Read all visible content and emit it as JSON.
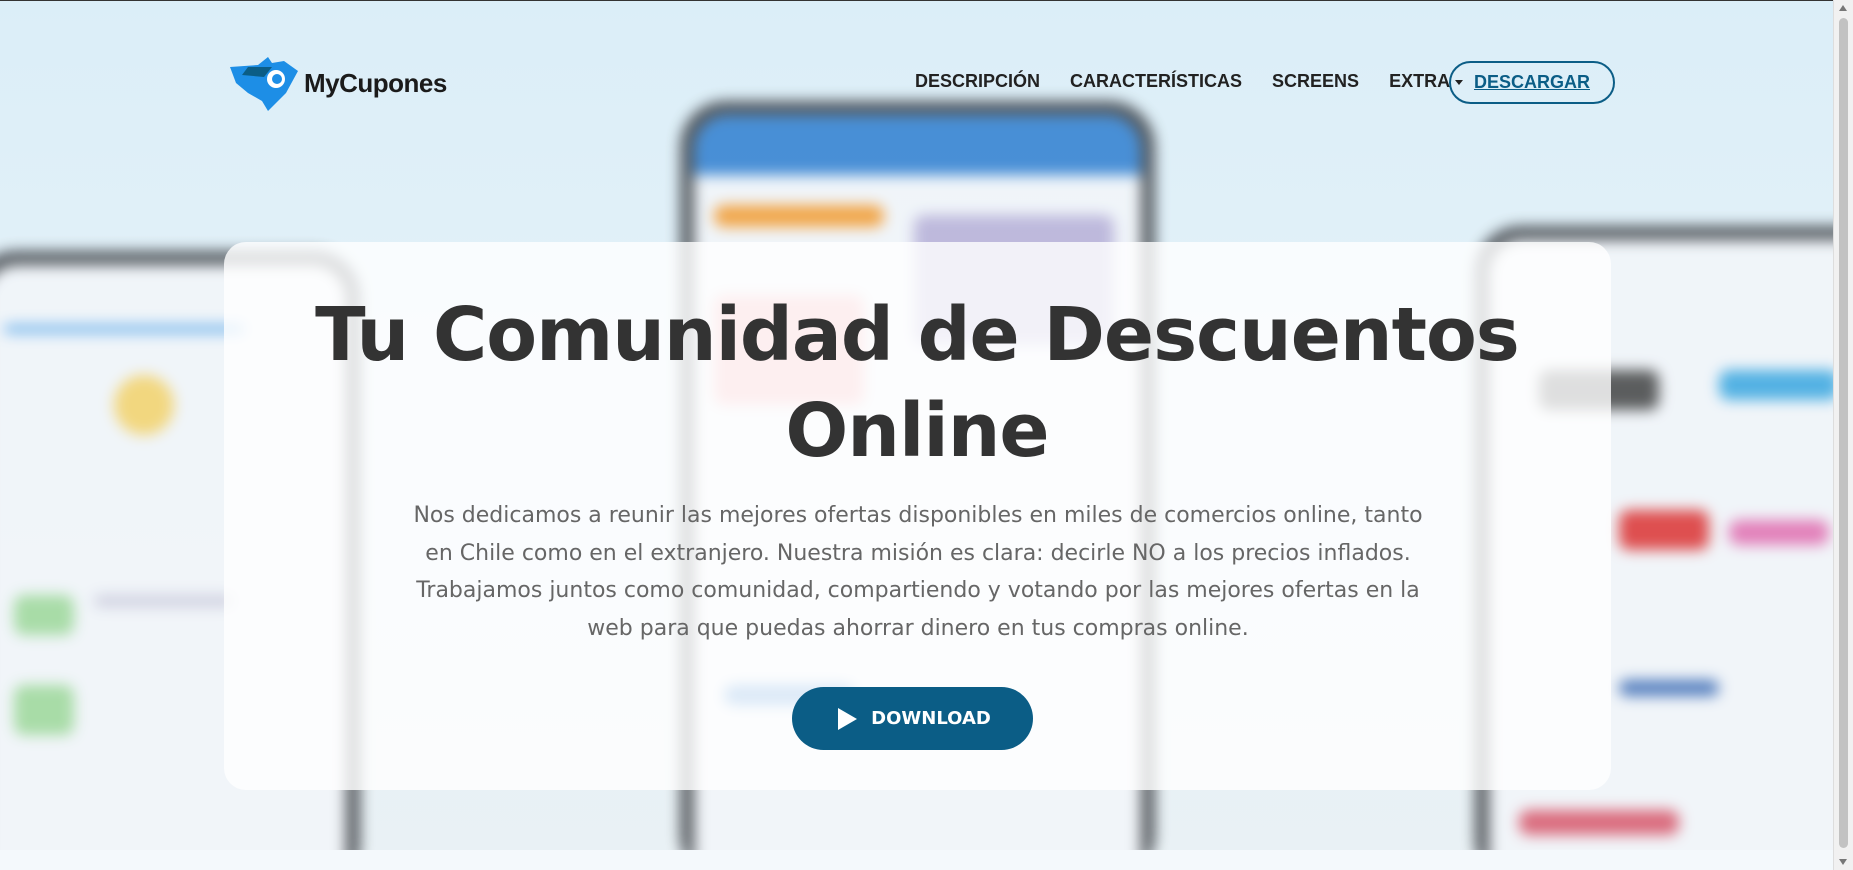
{
  "brand": {
    "name": "MyCupones"
  },
  "nav": {
    "items": [
      "DESCRIPCIÓN",
      "CARACTERÍSTICAS",
      "SCREENS"
    ],
    "extra_label": "EXTRA",
    "cta_label": "DESCARGAR"
  },
  "hero": {
    "title_line1": "Tu Comunidad de Descuentos",
    "title_line2": "Online",
    "description": "Nos dedicamos a reunir las mejores ofertas disponibles en miles de comercios online, tanto en Chile como en el extranjero. Nuestra misión es clara: decirle NO a los precios inflados. Trabajamos juntos como comunidad, compartiendo y votando por las mejores ofertas en la web para que puedas ahorrar dinero en tus compras online.",
    "download_label": "DOWNLOAD"
  },
  "icons": {
    "logo": "bird-logo-icon",
    "play": "play-icon",
    "caret": "caret-down-icon"
  },
  "colors": {
    "primary": "#0b5d86",
    "logo_blue": "#1d8ee6",
    "title": "#333333",
    "text": "#666666"
  }
}
